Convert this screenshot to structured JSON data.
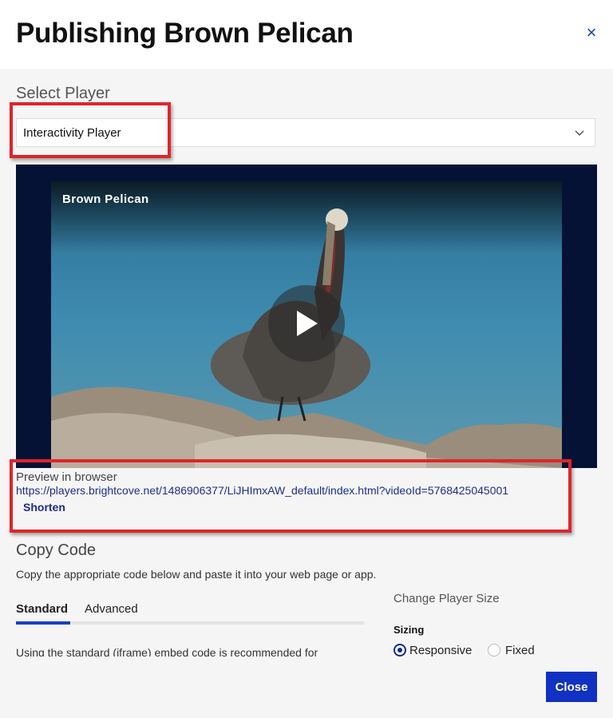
{
  "header": {
    "title": "Publishing Brown Pelican",
    "close_icon": "×"
  },
  "select_player": {
    "label": "Select Player",
    "selected": "Interactivity Player"
  },
  "video": {
    "title": "Brown Pelican"
  },
  "preview": {
    "label": "Preview in browser",
    "url": "https://players.brightcove.net/1486906377/LiJHImxAW_default/index.html?videoId=5768425045001",
    "shorten_label": "Shorten"
  },
  "copy_code": {
    "title": "Copy Code",
    "description": "Copy the appropriate code below and paste it into your web page or app.",
    "tabs": [
      {
        "label": "Standard",
        "active": true
      },
      {
        "label": "Advanced",
        "active": false
      }
    ],
    "standard_text": "Using the standard (iframe) embed code is recommended for"
  },
  "player_size": {
    "title": "Change Player Size",
    "sizing_label": "Sizing",
    "options": [
      {
        "label": "Responsive",
        "checked": true
      },
      {
        "label": "Fixed",
        "checked": false
      }
    ]
  },
  "footer": {
    "close_label": "Close"
  },
  "colors": {
    "accent": "#1131c2",
    "annotation": "#e0242a",
    "link": "#1f2d8c"
  }
}
